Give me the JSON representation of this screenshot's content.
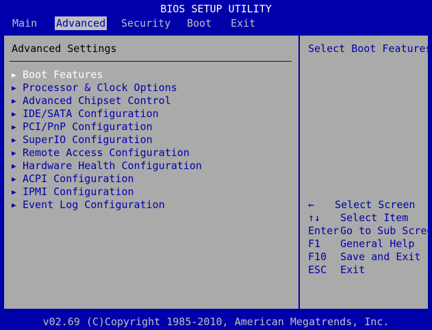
{
  "title": "BIOS SETUP UTILITY",
  "menu": [
    {
      "label": "Main"
    },
    {
      "label": "Advanced"
    },
    {
      "label": "Security"
    },
    {
      "label": "Boot"
    },
    {
      "label": "Exit"
    }
  ],
  "panel": {
    "heading": "Advanced Settings",
    "items": [
      {
        "label": "Boot Features"
      },
      {
        "label": "Processor & Clock Options"
      },
      {
        "label": "Advanced Chipset Control"
      },
      {
        "label": "IDE/SATA Configuration"
      },
      {
        "label": "PCI/PnP Configuration"
      },
      {
        "label": "SuperIO Configuration"
      },
      {
        "label": "Remote Access Configuration"
      },
      {
        "label": "Hardware Health Configuration"
      },
      {
        "label": "ACPI Configuration"
      },
      {
        "label": "IPMI Configuration"
      },
      {
        "label": "Event Log Configuration"
      }
    ]
  },
  "help": {
    "text": "Select Boot Features",
    "keys": [
      {
        "key": "←",
        "action": "Select Screen"
      },
      {
        "key": "↑↓",
        "action": "Select Item"
      },
      {
        "key": "Enter",
        "action": "Go to Sub Screen"
      },
      {
        "key": "F1",
        "action": "General Help"
      },
      {
        "key": "F10",
        "action": "Save and Exit"
      },
      {
        "key": "ESC",
        "action": "Exit"
      }
    ]
  },
  "footer": "v02.69 (C)Copyright 1985-2010, American Megatrends, Inc.",
  "colors": {
    "background": "#0000aa",
    "panel": "#aaaaaa",
    "text_blue": "#0000aa",
    "highlight": "#ffffff"
  }
}
